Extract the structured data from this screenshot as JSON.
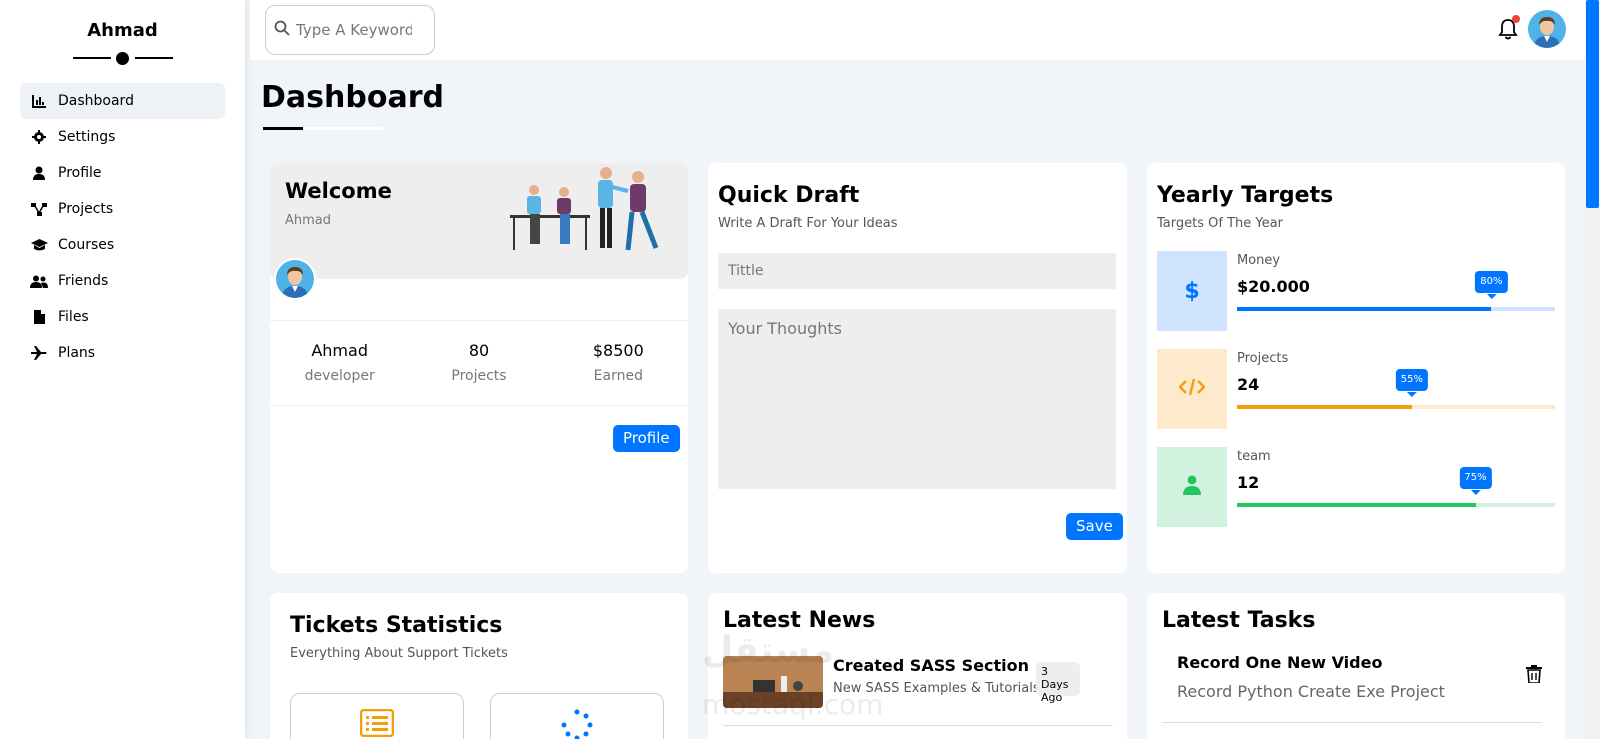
{
  "brand": {
    "name": "Ahmad"
  },
  "sidebar": {
    "items": [
      {
        "label": "Dashboard",
        "icon": "chart-icon",
        "active": true
      },
      {
        "label": "Settings",
        "icon": "gear-icon"
      },
      {
        "label": "Profile",
        "icon": "user-icon"
      },
      {
        "label": "Projects",
        "icon": "diagram-icon"
      },
      {
        "label": "Courses",
        "icon": "graduation-cap-icon"
      },
      {
        "label": "Friends",
        "icon": "users-icon"
      },
      {
        "label": "Files",
        "icon": "file-icon"
      },
      {
        "label": "Plans",
        "icon": "plane-icon"
      }
    ]
  },
  "header": {
    "search_placeholder": "Type A Keyword"
  },
  "page": {
    "title": "Dashboard"
  },
  "welcome": {
    "title": "Welcome",
    "name": "Ahmad",
    "stats": [
      {
        "value": "Ahmad",
        "label": "developer"
      },
      {
        "value": "80",
        "label": "Projects"
      },
      {
        "value": "$8500",
        "label": "Earned"
      }
    ],
    "button": "Profile"
  },
  "draft": {
    "title": "Quick Draft",
    "subtitle": "Write A Draft For Your Ideas",
    "title_placeholder": "Tittle",
    "body_placeholder": "Your Thoughts",
    "button": "Save"
  },
  "targets": {
    "title": "Yearly Targets",
    "subtitle": "Targets Of The Year",
    "items": [
      {
        "label": "Money",
        "value": "$20.000",
        "percent": 80,
        "percent_label": "80%",
        "color": "#0075ff",
        "track": "#cfe3ff",
        "bg": "#cfe3ff"
      },
      {
        "label": "Projects",
        "value": "24",
        "percent": 55,
        "percent_label": "55%",
        "color": "#f59e0b",
        "track": "#fdeacc",
        "bg": "#fdeacc"
      },
      {
        "label": "team",
        "value": "12",
        "percent": 75,
        "percent_label": "75%",
        "color": "#22c55e",
        "track": "#d1f2df",
        "bg": "#d1f2df"
      }
    ]
  },
  "tickets": {
    "title": "Tickets Statistics",
    "subtitle": "Everything About Support Tickets"
  },
  "news": {
    "title": "Latest News",
    "items": [
      {
        "title": "Created SASS Section",
        "desc": "New SASS Examples & Tutorials",
        "date": "3 Days Ago"
      }
    ]
  },
  "tasks": {
    "title": "Latest Tasks",
    "items": [
      {
        "title": "Record One New Video",
        "desc": "Record Python Create Exe Project"
      }
    ]
  },
  "watermark": {
    "line1": "مستقل",
    "line2": "mostaql.com"
  }
}
